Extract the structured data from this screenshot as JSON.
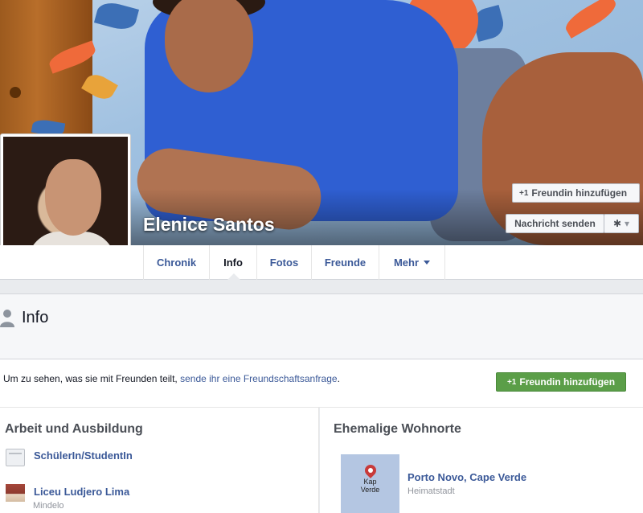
{
  "profile": {
    "name": "Elenice Santos"
  },
  "cover_actions": {
    "add_friend": "Freundin hinzufügen",
    "add_friend_icon": "+1",
    "message": "Nachricht senden",
    "gear_icon": "✱",
    "gear_caret": "▾"
  },
  "nav": {
    "tabs": [
      {
        "label": "Chronik"
      },
      {
        "label": "Info"
      },
      {
        "label": "Fotos"
      },
      {
        "label": "Freunde"
      },
      {
        "label": "Mehr"
      }
    ],
    "active": "Info"
  },
  "info_section": {
    "title": "Info"
  },
  "notice": {
    "text": "Um zu sehen, was sie mit Freunden teilt,",
    "link": "sende ihr eine Freundschaftsanfrage",
    "end": ".",
    "button": "Freundin hinzufügen",
    "button_icon": "+1"
  },
  "work_education": {
    "title": "Arbeit und Ausbildung",
    "items": [
      {
        "title": "SchülerIn/StudentIn",
        "sub": ""
      },
      {
        "title": "Liceu Ludjero Lima",
        "sub": "Mindelo"
      }
    ]
  },
  "places": {
    "title": "Ehemalige Wohnorte",
    "map_label_1": "Kap",
    "map_label_2": "Verde",
    "items": [
      {
        "title": "Porto Novo, Cape Verde",
        "sub": "Heimatstadt"
      }
    ]
  },
  "colors": {
    "link": "#3b5998",
    "green_button": "#5b9e48",
    "background": "#e9ebee"
  }
}
